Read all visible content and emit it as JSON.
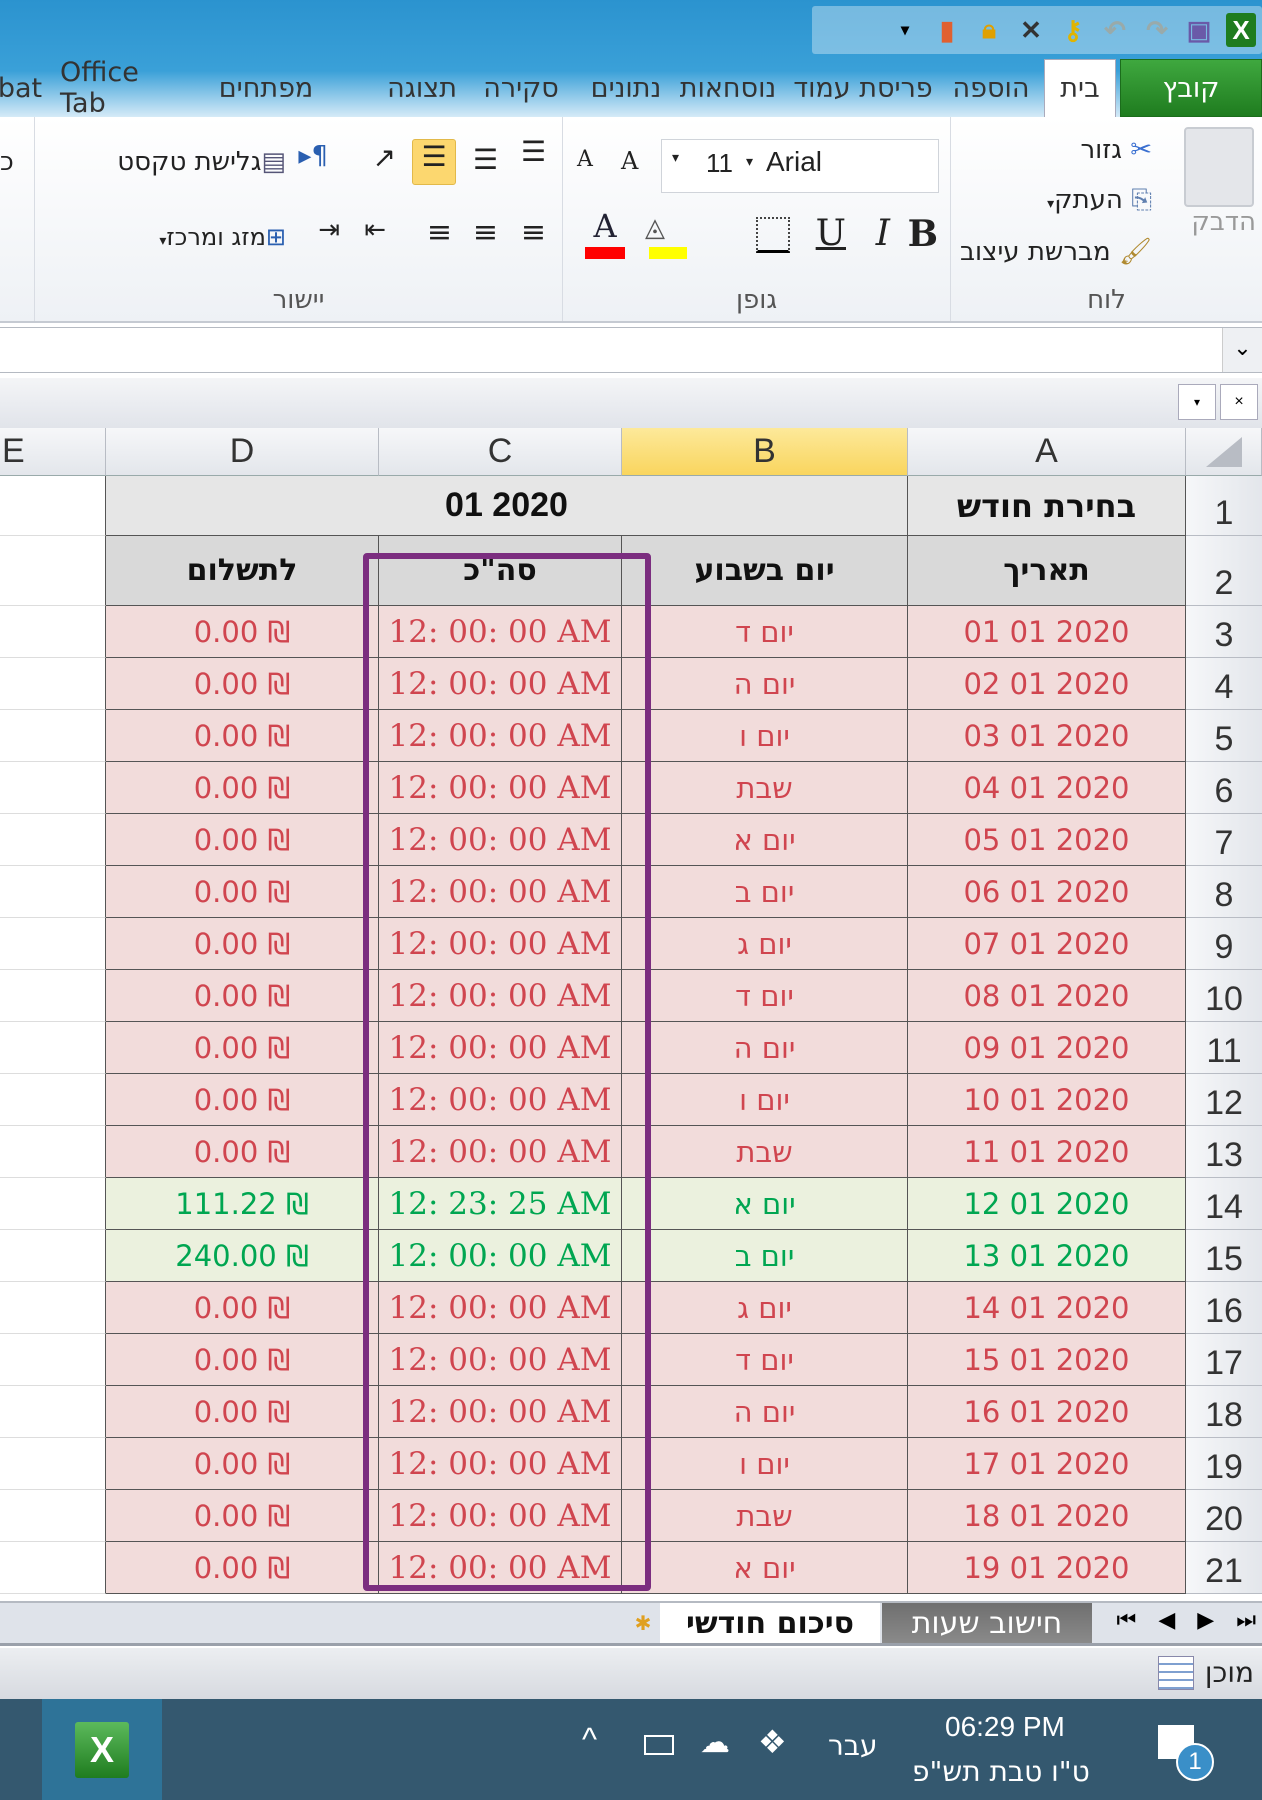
{
  "ribbon": {
    "tabs": [
      "קובץ",
      "בית",
      "הוספה",
      "פריסת עמוד",
      "נוסחאות",
      "נתונים",
      "סקירה",
      "תצוגה",
      "מפתחים",
      "Office Tab",
      "bat"
    ],
    "clipboard": {
      "label": "לוח",
      "paste": "הדבק",
      "cut": "גזור",
      "copy": "העתק",
      "format_painter": "מברשת עיצוב"
    },
    "font": {
      "label": "גופן",
      "name": "Arial",
      "size": "11",
      "bold": "B",
      "italic": "I",
      "underline": "U",
      "grow": "A",
      "shrink": "A",
      "font_color": "A",
      "font_color_hex": "#ff0000",
      "highlight_hex": "#ffff00"
    },
    "alignment": {
      "label": "יישור",
      "wrap_text": "גלישת טקסט",
      "merge_center": "מזג ומרכז",
      "partial": "כ"
    }
  },
  "grid": {
    "columns": [
      "E",
      "D",
      "C",
      "B",
      "A"
    ],
    "selected_column": "B",
    "row1": {
      "a": "בחירת חודש",
      "month": "01 2020"
    },
    "headers": {
      "date": "תאריך",
      "weekday": "יום בשבוע",
      "total": "סה\"כ",
      "payment": "לתשלום"
    },
    "colors": {
      "pink_bg": "#f2dcdb",
      "green_bg": "#ebf1de",
      "red_text": "#d0454f",
      "green_text": "#00a651",
      "highlight_border": "#7b2d7f"
    },
    "rows": [
      {
        "n": 3,
        "date": "01 01 2020",
        "day": "יום ד",
        "total": "12: 00: 00 AM",
        "pay": "₪ 0.00",
        "status": "pink"
      },
      {
        "n": 4,
        "date": "02 01 2020",
        "day": "יום ה",
        "total": "12: 00: 00 AM",
        "pay": "₪ 0.00",
        "status": "pink"
      },
      {
        "n": 5,
        "date": "03 01 2020",
        "day": "יום ו",
        "total": "12: 00: 00 AM",
        "pay": "₪ 0.00",
        "status": "pink"
      },
      {
        "n": 6,
        "date": "04 01 2020",
        "day": "שבת",
        "total": "12: 00: 00 AM",
        "pay": "₪ 0.00",
        "status": "pink"
      },
      {
        "n": 7,
        "date": "05 01 2020",
        "day": "יום א",
        "total": "12: 00: 00 AM",
        "pay": "₪ 0.00",
        "status": "pink"
      },
      {
        "n": 8,
        "date": "06 01 2020",
        "day": "יום ב",
        "total": "12: 00: 00 AM",
        "pay": "₪ 0.00",
        "status": "pink"
      },
      {
        "n": 9,
        "date": "07 01 2020",
        "day": "יום ג",
        "total": "12: 00: 00 AM",
        "pay": "₪ 0.00",
        "status": "pink"
      },
      {
        "n": 10,
        "date": "08 01 2020",
        "day": "יום ד",
        "total": "12: 00: 00 AM",
        "pay": "₪ 0.00",
        "status": "pink"
      },
      {
        "n": 11,
        "date": "09 01 2020",
        "day": "יום ה",
        "total": "12: 00: 00 AM",
        "pay": "₪ 0.00",
        "status": "pink"
      },
      {
        "n": 12,
        "date": "10 01 2020",
        "day": "יום ו",
        "total": "12: 00: 00 AM",
        "pay": "₪ 0.00",
        "status": "pink"
      },
      {
        "n": 13,
        "date": "11 01 2020",
        "day": "שבת",
        "total": "12: 00: 00 AM",
        "pay": "₪ 0.00",
        "status": "pink"
      },
      {
        "n": 14,
        "date": "12 01 2020",
        "day": "יום א",
        "total": "12: 23: 25 AM",
        "pay": "₪ 111.22",
        "status": "green"
      },
      {
        "n": 15,
        "date": "13 01 2020",
        "day": "יום ב",
        "total": "12: 00: 00 AM",
        "pay": "₪ 240.00",
        "status": "green"
      },
      {
        "n": 16,
        "date": "14 01 2020",
        "day": "יום ג",
        "total": "12: 00: 00 AM",
        "pay": "₪ 0.00",
        "status": "pink"
      },
      {
        "n": 17,
        "date": "15 01 2020",
        "day": "יום ד",
        "total": "12: 00: 00 AM",
        "pay": "₪ 0.00",
        "status": "pink"
      },
      {
        "n": 18,
        "date": "16 01 2020",
        "day": "יום ה",
        "total": "12: 00: 00 AM",
        "pay": "₪ 0.00",
        "status": "pink"
      },
      {
        "n": 19,
        "date": "17 01 2020",
        "day": "יום ו",
        "total": "12: 00: 00 AM",
        "pay": "₪ 0.00",
        "status": "pink"
      },
      {
        "n": 20,
        "date": "18 01 2020",
        "day": "שבת",
        "total": "12: 00: 00 AM",
        "pay": "₪ 0.00",
        "status": "pink"
      },
      {
        "n": 21,
        "date": "19 01 2020",
        "day": "יום א",
        "total": "12: 00: 00 AM",
        "pay": "₪ 0.00",
        "status": "pink"
      }
    ]
  },
  "sheets": {
    "tab1": "חישוב שעות",
    "tab2": "סיכום חודשי",
    "active": "חישוב שעות"
  },
  "status": {
    "ready": "מוכן"
  },
  "taskbar": {
    "time": "06:29 PM",
    "date": "ט\"ו טבת תש\"פ",
    "language": "עבר",
    "notifications": "1"
  }
}
